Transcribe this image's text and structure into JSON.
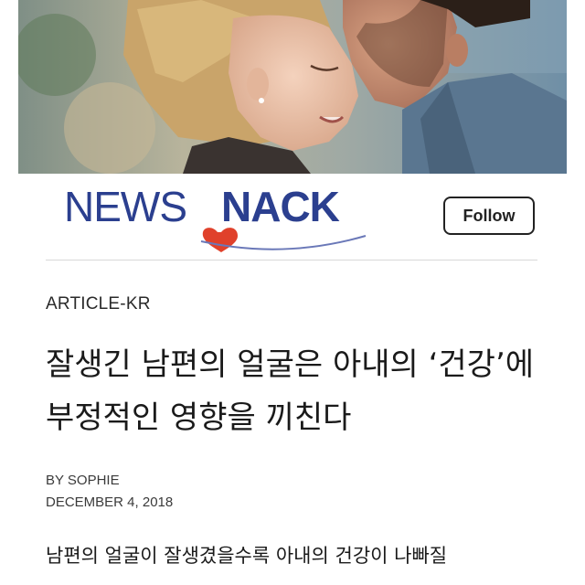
{
  "brand": {
    "logo_text_light": "NEWS",
    "logo_text_bold": "NACK",
    "logo_color_light": "#2b3f8f",
    "logo_color_bold": "#2b3f8f",
    "heart_color": "#e0412b",
    "swoosh_color": "#6a78b8"
  },
  "hero": {
    "image_description_icon": "couple-photo"
  },
  "follow": {
    "label": "Follow"
  },
  "article": {
    "category": "ARTICLE-KR",
    "headline": "잘생긴 남편의 얼굴은 아내의 ‘건강’에 부정적인 영향을 끼친다",
    "author": "BY SOPHIE",
    "date": "DECEMBER 4, 2018",
    "lead": "남편의 얼굴이 잘생겼을수록 아내의 건강이 나빠질"
  }
}
